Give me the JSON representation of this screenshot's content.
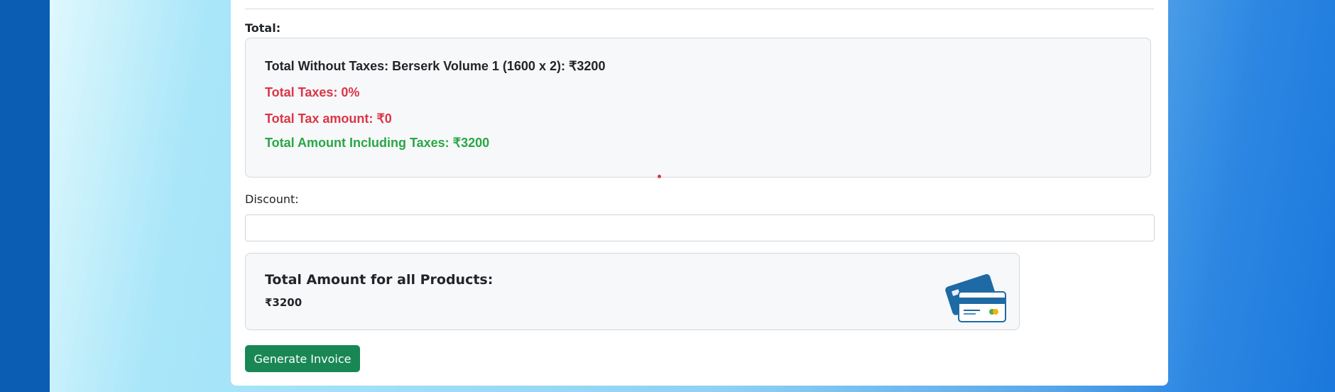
{
  "total_section": {
    "label": "Total:",
    "without_taxes": "Total Without Taxes: Berserk Volume 1 (1600 x 2): ₹3200",
    "taxes": "Total Taxes: 0%",
    "tax_amount": "Total Tax amount: ₹0",
    "including_taxes": "Total Amount Including Taxes: ₹3200"
  },
  "discount": {
    "label": "Discount:",
    "value": "",
    "placeholder": ""
  },
  "summary": {
    "title": "Total Amount for all Products:",
    "amount": "₹3200",
    "icon": "credit-card-icon"
  },
  "actions": {
    "generate_label": "Generate Invoice"
  },
  "colors": {
    "red": "#dc3545",
    "green": "#28a745",
    "button": "#198754",
    "card_blue": "#1d6aa5"
  }
}
